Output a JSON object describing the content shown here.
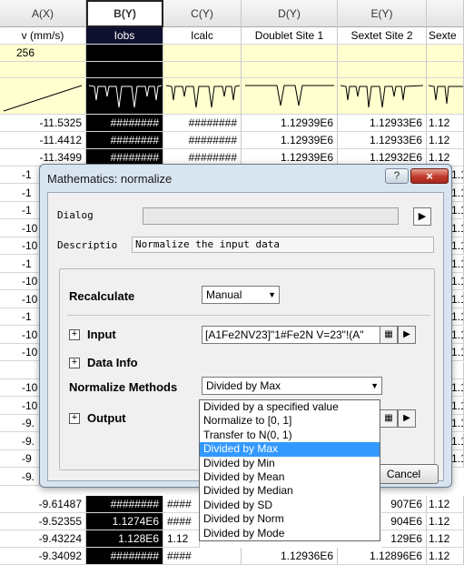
{
  "sheet": {
    "columns": [
      {
        "id": "A",
        "header": "A(X)",
        "label": "v (mm/s)",
        "units": "256"
      },
      {
        "id": "B",
        "header": "B(Y)",
        "label": "Iobs",
        "units": ""
      },
      {
        "id": "C",
        "header": "C(Y)",
        "label": "Icalc",
        "units": ""
      },
      {
        "id": "D",
        "header": "D(Y)",
        "label": "Doublet Site 1",
        "units": ""
      },
      {
        "id": "E",
        "header": "E(Y)",
        "label": "Sextet Site 2",
        "units": ""
      },
      {
        "id": "F",
        "header": "",
        "label": "Sexte",
        "units": ""
      }
    ],
    "top_rows": [
      [
        "-11.5325",
        "########",
        "########",
        "1.12939E6",
        "1.12933E6",
        "1.12"
      ],
      [
        "-11.4412",
        "########",
        "########",
        "1.12939E6",
        "1.12933E6",
        "1.12"
      ],
      [
        "-11.3499",
        "########",
        "########",
        "1.12939E6",
        "1.12932E6",
        "1.12"
      ]
    ],
    "left_fragments": [
      "-1",
      "-1",
      "-1",
      "-10",
      "-10",
      "-1",
      "-10",
      "-10",
      "-1",
      "-10",
      "-10",
      "",
      "-10",
      "-10",
      "-9.",
      "-9.",
      "-9",
      "-9."
    ],
    "right_fragments": [
      "1.1",
      "1.1",
      "1.1",
      "1.1",
      "1.12",
      "1.12",
      "1.1",
      "1.1",
      "1.12",
      "1.12",
      "1.12",
      "",
      "1.12",
      "1.12",
      "1.12",
      "1.12",
      "1.12"
    ],
    "bottom_rows": [
      [
        "-9.61487",
        "########",
        "####",
        "907E6",
        "1.12"
      ],
      [
        "-9.52355",
        "1.1274E6",
        "####",
        "904E6",
        "1.12"
      ],
      [
        "-9.43224",
        "1.128E6",
        "1.12",
        "129E6",
        "1.12"
      ],
      [
        "-9.34092",
        "########",
        "####",
        "1.12936E6",
        "1.12896E6",
        "1.12"
      ]
    ]
  },
  "dialog": {
    "title": "Mathematics: normalize",
    "help_glyph": "?",
    "close_glyph": "×",
    "dialog_label": "Dialog",
    "description_label": "Descriptio",
    "description_value": "Normalize the input data",
    "recalculate_label": "Recalculate",
    "recalculate_value": "Manual",
    "input_label": "Input",
    "input_value": "[A1Fe2NV23]\"1#Fe2N V=23\"!(A\"",
    "data_info_label": "Data Info",
    "methods_label": "Normalize Methods",
    "methods_value": "Divided by Max",
    "output_label": "Output",
    "cancel_label": "Cancel"
  },
  "dropdown": {
    "options": [
      "Divided by a specified value",
      "Normalize to [0, 1]",
      "Transfer to N(0, 1)",
      "Divided by Max",
      "Divided by Min",
      "Divided by Mean",
      "Divided by Median",
      "Divided by SD",
      "Divided by Norm",
      "Divided by Mode"
    ],
    "selected": "Divided by Max"
  },
  "colors": {
    "selection_blue": "#3399ff",
    "close_red": "#c0392b",
    "selected_column_bg": "#000000"
  },
  "icons": [
    "arrow-right-icon",
    "column-browser-icon",
    "expand-plus-icon",
    "dropdown-arrow-icon",
    "close-icon",
    "help-icon"
  ]
}
